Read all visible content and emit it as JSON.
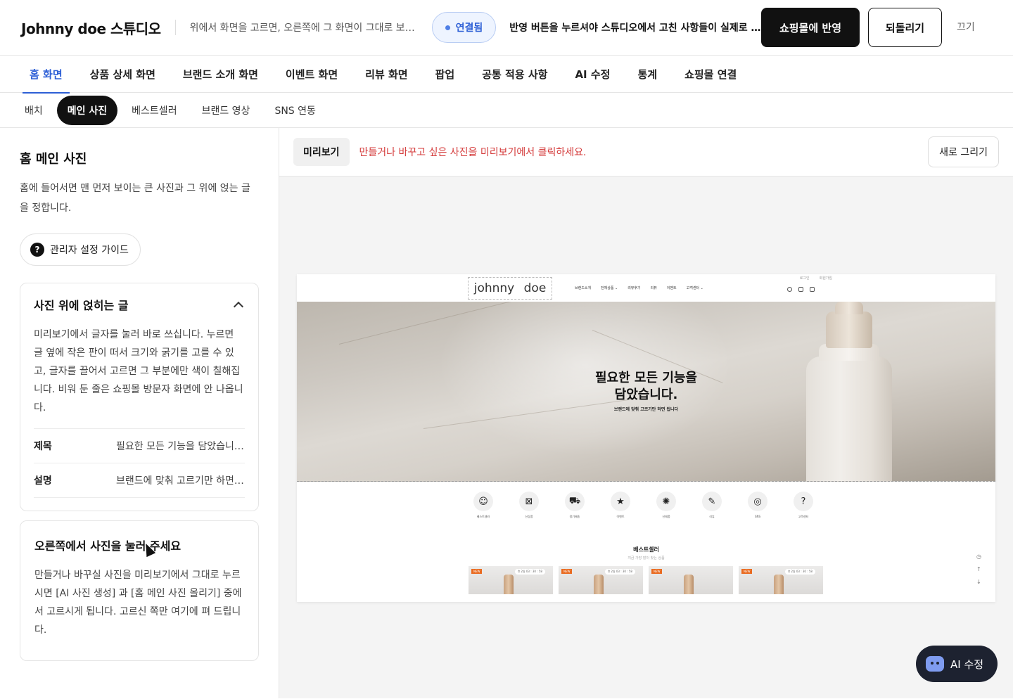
{
  "header": {
    "brand": "Johnny doe 스튜디오",
    "description": "위에서 화면을 고르면, 오른쪽에 그 화면이 그대로 보입니다",
    "connection_status": "연결됨",
    "notice": "반영 버튼을 누르셔야 스튜디오에서 고친 사항들이 실제로 쇼핑몰에 반영됩니다",
    "publish_label": "쇼핑몰에 반영",
    "revert_label": "되돌리기",
    "close_label": "끄기"
  },
  "main_tabs": [
    "홈 화면",
    "상품 상세 화면",
    "브랜드 소개 화면",
    "이벤트 화면",
    "리뷰 화면",
    "팝업",
    "공통 적용 사항",
    "AI 수정",
    "통계",
    "쇼핑몰 연결"
  ],
  "sub_tabs": [
    "배치",
    "메인 사진",
    "베스트셀러",
    "브랜드 영상",
    "SNS 연동"
  ],
  "left": {
    "title": "홈 메인 사진",
    "description": "홈에 들어서면 맨 먼저 보이는 큰 사진과 그 위에 얹는 글을 정합니다.",
    "guide_label": "관리자 설정 가이드",
    "guide_icon": "?",
    "card1": {
      "title": "사진 위에 얹히는 글",
      "body": "미리보기에서 글자를 눌러 바로 쓰십니다. 누르면 글 옆에 작은 판이 떠서 크기와 굵기를 고를 수 있고, 글자를 끌어서 고르면 그 부분에만 색이 칠해집니다. 비워 둔 줄은 쇼핑몰 방문자 화면에 안 나옵니다.",
      "fields": [
        {
          "key": "제목",
          "value": "필요한 모든 기능을 담았습니다."
        },
        {
          "key": "설명",
          "value": "브랜드에 맞춰 고르기만 하면 됩니다"
        }
      ]
    },
    "card2": {
      "title": "오른쪽에서 사진을 눌러 주세요",
      "body": "만들거나 바꾸실 사진을 미리보기에서 그대로 누르시면 [AI 사진 생성] 과 [홈 메인 사진 올리기] 중에서 고르시게 됩니다. 고르신 쪽만 여기에 펴 드립니다."
    }
  },
  "preview": {
    "label": "미리보기",
    "message": "만들거나 바꾸고 싶은 사진을 미리보기에서 클릭하세요.",
    "redraw_label": "새로 그리기",
    "site": {
      "top_links": [
        "로그인",
        "회원가입"
      ],
      "logo": "johnny doe",
      "menu": [
        "브랜드소개",
        "전체상품 ⌄",
        "리뷰후기",
        "리뷰",
        "이벤트",
        "고객센터 ⌄"
      ],
      "hero_title": "필요한 모든 기능을\n담았습니다.",
      "hero_subtitle": "브랜드에 맞춰 고르기만 하면 됩니다",
      "categories": [
        {
          "label": "베스트셀러",
          "icon": "☺"
        },
        {
          "label": "신상품",
          "icon": "⊠"
        },
        {
          "label": "정기배송",
          "icon": "⛟"
        },
        {
          "label": "이벤트",
          "icon": "★"
        },
        {
          "label": "신제품",
          "icon": "✺"
        },
        {
          "label": "리뷰",
          "icon": "✎"
        },
        {
          "label": "SNS",
          "icon": "◎"
        },
        {
          "label": "고객센터",
          "icon": "?"
        }
      ],
      "best_title": "베스트셀러",
      "best_subtitle": "지금 가장 많이 찾는 상품",
      "products": [
        {
          "badge": "NEW",
          "timer": "⏱ 2일 03 : 30 : 58"
        },
        {
          "badge": "NEW",
          "timer": "⏱ 2일 03 : 30 : 58"
        },
        {
          "badge": "NEW",
          "timer": ""
        },
        {
          "badge": "NEW",
          "timer": "⏱ 2일 03 : 30 : 58"
        }
      ],
      "side_buttons": [
        "◷",
        "↑",
        "↓"
      ]
    }
  },
  "ai_button": {
    "label": "AI 수정"
  },
  "colors": {
    "accent": "#2d5fd6",
    "primary": "#111111",
    "alert": "#d43a3a",
    "badge": "#e96a1f",
    "ai_button_bg": "#1d2230"
  }
}
